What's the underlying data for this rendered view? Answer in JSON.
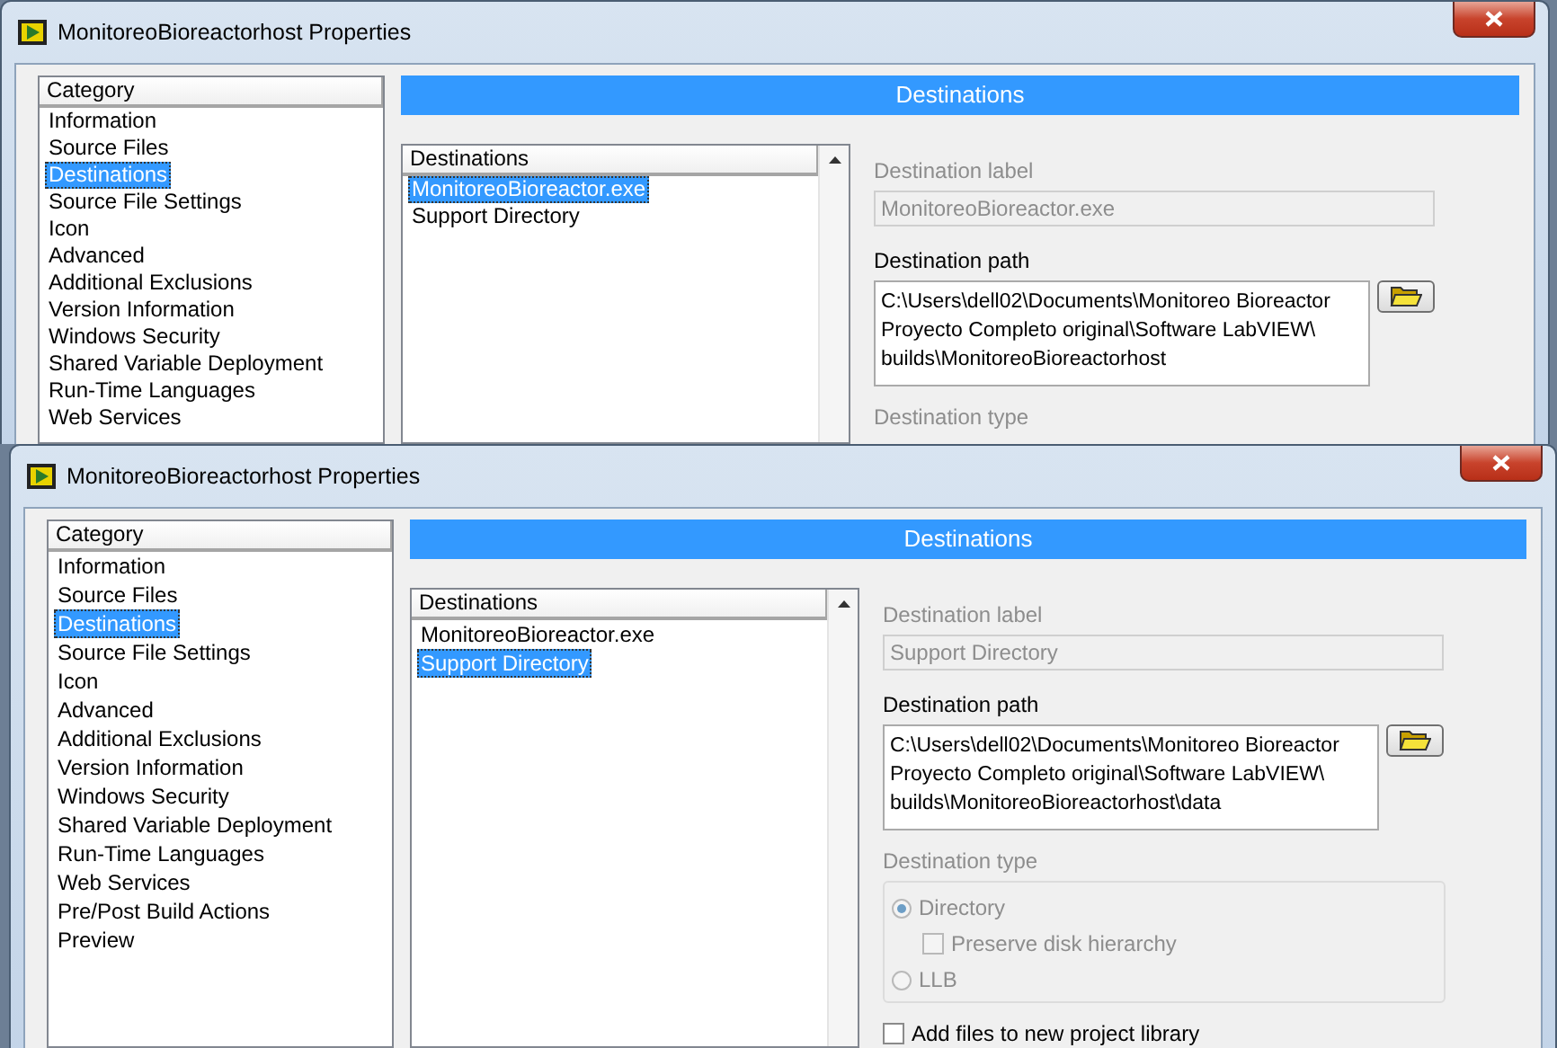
{
  "windows": [
    {
      "title": "MonitoreoBioreactorhost Properties",
      "sidebar": {
        "header": "Category",
        "items": [
          {
            "label": "Information",
            "selected": false
          },
          {
            "label": "Source Files",
            "selected": false
          },
          {
            "label": "Destinations",
            "selected": true
          },
          {
            "label": "Source File Settings",
            "selected": false
          },
          {
            "label": "Icon",
            "selected": false
          },
          {
            "label": "Advanced",
            "selected": false
          },
          {
            "label": "Additional Exclusions",
            "selected": false
          },
          {
            "label": "Version Information",
            "selected": false
          },
          {
            "label": "Windows Security",
            "selected": false
          },
          {
            "label": "Shared Variable Deployment",
            "selected": false
          },
          {
            "label": "Run-Time Languages",
            "selected": false
          },
          {
            "label": "Web Services",
            "selected": false
          }
        ]
      },
      "banner": "Destinations",
      "destinations": {
        "header": "Destinations",
        "items": [
          {
            "label": "MonitoreoBioreactor.exe",
            "selected": true
          },
          {
            "label": "Support Directory",
            "selected": false
          }
        ]
      },
      "destination_label": {
        "label": "Destination label",
        "value": "MonitoreoBioreactor.exe",
        "disabled": true
      },
      "destination_path": {
        "label": "Destination path",
        "value_lines": [
          "C:\\Users\\dell02\\Documents\\Monitoreo Bioreactor",
          "Proyecto Completo original\\Software LabVIEW\\",
          "builds\\MonitoreoBioreactorhost"
        ]
      },
      "destination_type": {
        "label": "Destination type",
        "disabled": true
      }
    },
    {
      "title": "MonitoreoBioreactorhost Properties",
      "sidebar": {
        "header": "Category",
        "items": [
          {
            "label": "Information",
            "selected": false
          },
          {
            "label": "Source Files",
            "selected": false
          },
          {
            "label": "Destinations",
            "selected": true
          },
          {
            "label": "Source File Settings",
            "selected": false
          },
          {
            "label": "Icon",
            "selected": false
          },
          {
            "label": "Advanced",
            "selected": false
          },
          {
            "label": "Additional Exclusions",
            "selected": false
          },
          {
            "label": "Version Information",
            "selected": false
          },
          {
            "label": "Windows Security",
            "selected": false
          },
          {
            "label": "Shared Variable Deployment",
            "selected": false
          },
          {
            "label": "Run-Time Languages",
            "selected": false
          },
          {
            "label": "Web Services",
            "selected": false
          },
          {
            "label": "Pre/Post Build Actions",
            "selected": false
          },
          {
            "label": "Preview",
            "selected": false
          }
        ]
      },
      "banner": "Destinations",
      "destinations": {
        "header": "Destinations",
        "items": [
          {
            "label": "MonitoreoBioreactor.exe",
            "selected": false
          },
          {
            "label": "Support Directory",
            "selected": true
          }
        ]
      },
      "destination_label": {
        "label": "Destination label",
        "value": "Support Directory",
        "disabled": true
      },
      "destination_path": {
        "label": "Destination path",
        "value_lines": [
          "C:\\Users\\dell02\\Documents\\Monitoreo Bioreactor",
          "Proyecto Completo original\\Software LabVIEW\\",
          "builds\\MonitoreoBioreactorhost\\data"
        ]
      },
      "destination_type": {
        "label": "Destination type",
        "disabled": true,
        "options": [
          {
            "kind": "radio",
            "label": "Directory",
            "selected": true
          },
          {
            "kind": "checkbox",
            "label": "Preserve disk hierarchy",
            "checked": false
          },
          {
            "kind": "radio",
            "label": "LLB",
            "selected": false
          }
        ]
      },
      "add_files": {
        "label": "Add files to new project library",
        "checked": false
      }
    }
  ]
}
